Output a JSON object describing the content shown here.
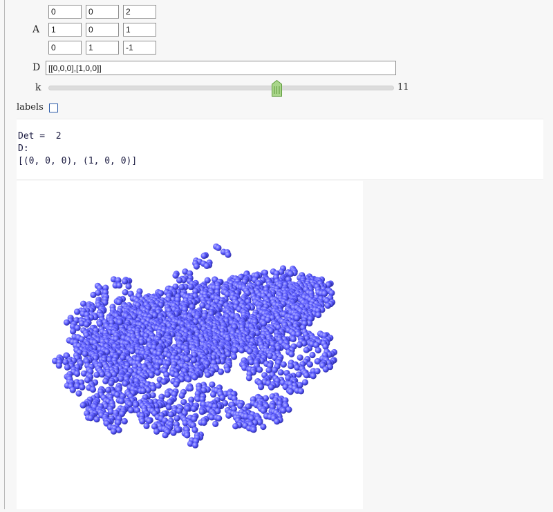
{
  "matrix": {
    "label": "A",
    "rows": [
      [
        "0",
        "0",
        "2"
      ],
      [
        "1",
        "0",
        "1"
      ],
      [
        "0",
        "1",
        "-1"
      ]
    ]
  },
  "digits": {
    "label": "D",
    "value": "[[0,0,0],[1,0,0]]"
  },
  "slider": {
    "label": "k",
    "value": 11,
    "fraction": 0.66
  },
  "labels_toggle": {
    "label": "labels",
    "checked": false
  },
  "output": {
    "det_line": "Det =  2",
    "d_line": "D:",
    "d_value": "[(0, 0, 0), (1, 0, 0)]"
  },
  "plot": {
    "sphere_color": "#5a5aff",
    "description_icon": "point-cloud-3d"
  },
  "colors": {
    "accent_slider": "#7ab648",
    "checkbox_border": "#2a5aa8"
  }
}
